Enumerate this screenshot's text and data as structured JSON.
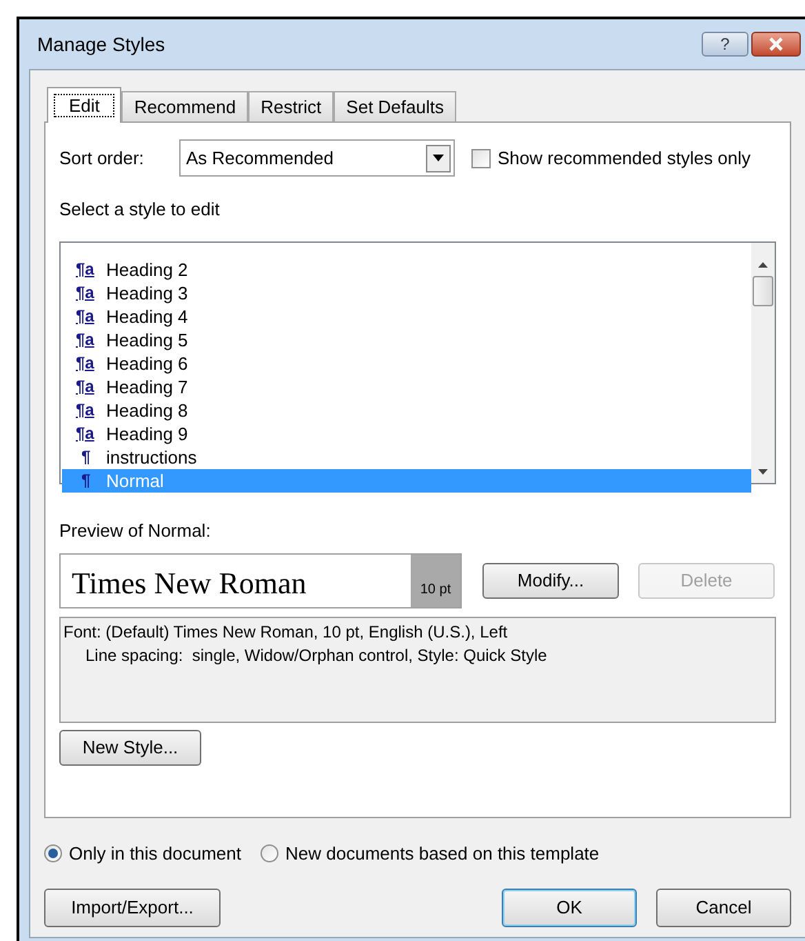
{
  "window": {
    "title": "Manage Styles",
    "help": "?"
  },
  "tabs": [
    {
      "label": "Edit",
      "selected": true
    },
    {
      "label": "Recommend",
      "selected": false
    },
    {
      "label": "Restrict",
      "selected": false
    },
    {
      "label": "Set Defaults",
      "selected": false
    }
  ],
  "sort_order": {
    "label": "Sort order:",
    "value": "As Recommended"
  },
  "show_recommended": {
    "label": "Show recommended styles only",
    "checked": false
  },
  "list_label": "Select a style to edit",
  "styles": [
    {
      "icon": "¶a",
      "kind": "linked",
      "name": "Heading 2",
      "selected": false
    },
    {
      "icon": "¶a",
      "kind": "linked",
      "name": "Heading 3",
      "selected": false
    },
    {
      "icon": "¶a",
      "kind": "linked",
      "name": "Heading 4",
      "selected": false
    },
    {
      "icon": "¶a",
      "kind": "linked",
      "name": "Heading 5",
      "selected": false
    },
    {
      "icon": "¶a",
      "kind": "linked",
      "name": "Heading 6",
      "selected": false
    },
    {
      "icon": "¶a",
      "kind": "linked",
      "name": "Heading 7",
      "selected": false
    },
    {
      "icon": "¶a",
      "kind": "linked",
      "name": "Heading 8",
      "selected": false
    },
    {
      "icon": "¶a",
      "kind": "linked",
      "name": "Heading 9",
      "selected": false
    },
    {
      "icon": "¶",
      "kind": "paragraph",
      "name": "instructions",
      "selected": false
    },
    {
      "icon": "¶",
      "kind": "paragraph",
      "name": "Normal",
      "selected": true
    }
  ],
  "preview": {
    "label": "Preview of Normal:",
    "font_sample": "Times New Roman",
    "size": "10 pt"
  },
  "modify_button": {
    "label": "Modify...",
    "disabled": false
  },
  "delete_button": {
    "label": "Delete",
    "disabled": true
  },
  "description": [
    "Font: (Default) Times New Roman, 10 pt, English (U.S.), Left",
    "Line spacing:  single, Widow/Orphan control, Style: Quick Style"
  ],
  "new_style_button": "New Style...",
  "scope": [
    {
      "label": "Only in this document",
      "selected": true
    },
    {
      "label": "New documents based on this template",
      "selected": false
    }
  ],
  "buttons": [
    {
      "label": "Import/Export...",
      "kind": "left"
    },
    {
      "label": "OK",
      "kind": "default"
    },
    {
      "label": "Cancel",
      "kind": "normal"
    }
  ]
}
